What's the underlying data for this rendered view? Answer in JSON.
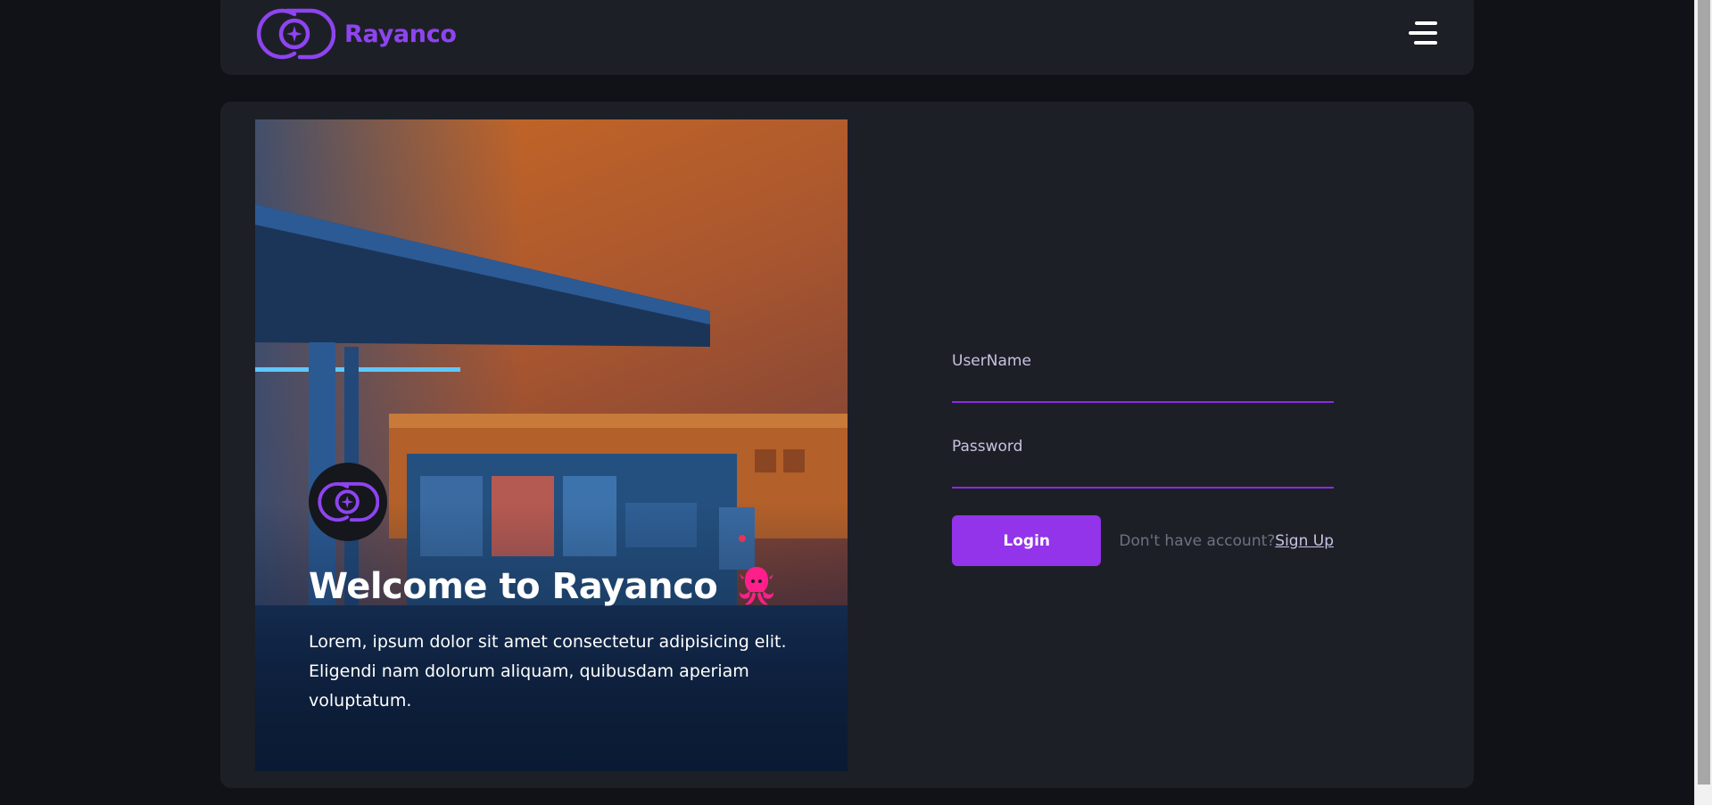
{
  "header": {
    "brand_name": "Rayanco",
    "logo_icon": "rayanco-logo-icon",
    "menu_icon": "hamburger-menu-icon"
  },
  "hero": {
    "title": "Welcome to Rayanco",
    "description": "Lorem, ipsum dolor sit amet consectetur adipisicing elit. Eligendi nam dolorum aliquam, quibusdam aperiam voluptatum.",
    "image_icon": "gas-station-photo",
    "avatar_icon": "rayanco-logo-icon",
    "emoji_icon": "octopus-icon"
  },
  "login": {
    "username_label": "UserName",
    "username_value": "",
    "password_label": "Password",
    "password_value": "",
    "login_button": "Login",
    "signup_prompt": "Don't have account?",
    "signup_link": "Sign Up"
  },
  "colors": {
    "accent": "#9333ea",
    "brand": "#8e44f0",
    "background": "#101217",
    "card": "#1d1f26",
    "label": "#c7c3e3",
    "muted": "#6b7280",
    "octopus": "#ff1f8a"
  }
}
